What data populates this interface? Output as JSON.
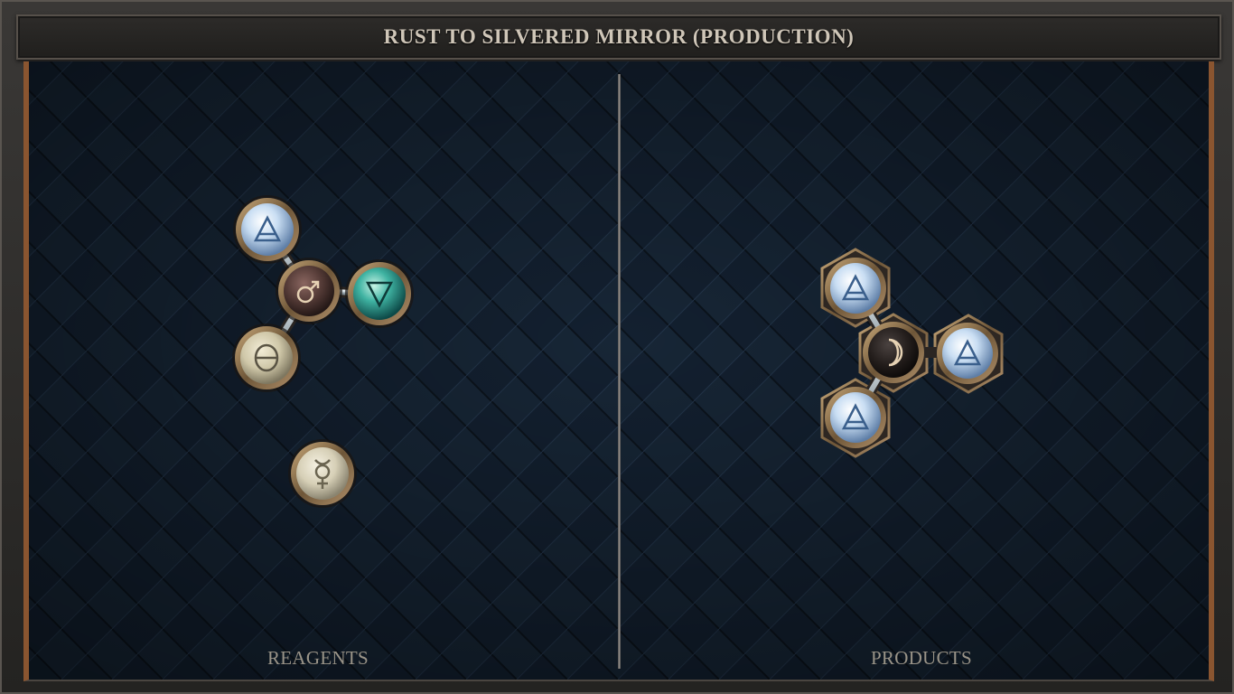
{
  "title": "RUST TO SILVERED MIRROR (PRODUCTION)",
  "panels": {
    "reagents_label": "REAGENTS",
    "products_label": "PRODUCTS"
  },
  "reagents": {
    "molecule_1": {
      "atoms": [
        {
          "id": "iron",
          "element": "iron",
          "glyph": "♂",
          "color": "#6b4a45"
        },
        {
          "id": "air",
          "element": "air",
          "glyph": "🜁",
          "color": "#bfd8f0"
        },
        {
          "id": "water",
          "element": "water",
          "glyph": "🜄",
          "color": "#3aa89c"
        },
        {
          "id": "salt",
          "element": "salt",
          "glyph": "θ",
          "color": "#d9d2b8"
        }
      ]
    },
    "molecule_2": {
      "atoms": [
        {
          "id": "quicksilver",
          "element": "quicksilver",
          "glyph": "☿",
          "color": "#e3ddc8"
        }
      ]
    }
  },
  "products": {
    "molecule_1": {
      "atoms": [
        {
          "id": "silver",
          "element": "silver",
          "glyph": "☽",
          "color": "#2a2422"
        },
        {
          "id": "air_top",
          "element": "air",
          "glyph": "🜁",
          "color": "#bfd8f0"
        },
        {
          "id": "air_right",
          "element": "air",
          "glyph": "🜁",
          "color": "#bfd8f0"
        },
        {
          "id": "air_bottom",
          "element": "air",
          "glyph": "🜁",
          "color": "#bfd8f0"
        }
      ]
    }
  },
  "colors": {
    "board_bg": "#14202c",
    "frame_wood": "#8a5530",
    "title_text": "#cfc6b8",
    "label_text": "#9a9488",
    "bond": "#b8c4cc",
    "brass": "#a08460"
  }
}
